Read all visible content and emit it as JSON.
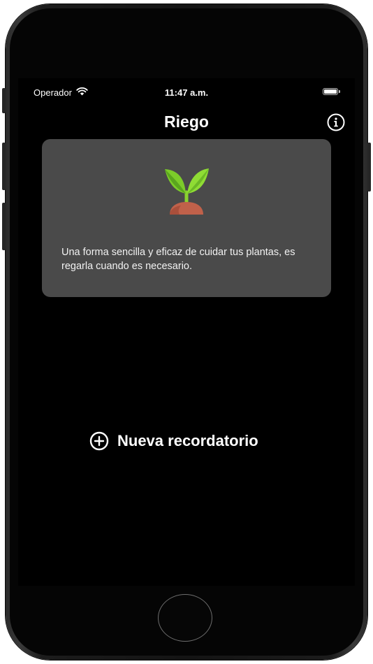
{
  "status_bar": {
    "carrier": "Operador",
    "time": "11:47 a.m.",
    "wifi_icon": "wifi-icon",
    "battery_icon": "battery-icon"
  },
  "nav": {
    "title": "Riego",
    "info_icon": "info-circle-icon"
  },
  "card": {
    "illustration_icon": "plant-sprout-icon",
    "text": "Una forma sencilla y eficaz de cuidar tus plantas, es regarla cuando es necesario.",
    "background_color": "#4a4a4a"
  },
  "actions": {
    "new_reminder_label": "Nueva recordatorio",
    "new_reminder_icon": "plus-circle-icon"
  },
  "colors": {
    "screen_background": "#000000",
    "text": "#ffffff",
    "leaf": "#7ccc2a",
    "soil": "#c0614a"
  }
}
